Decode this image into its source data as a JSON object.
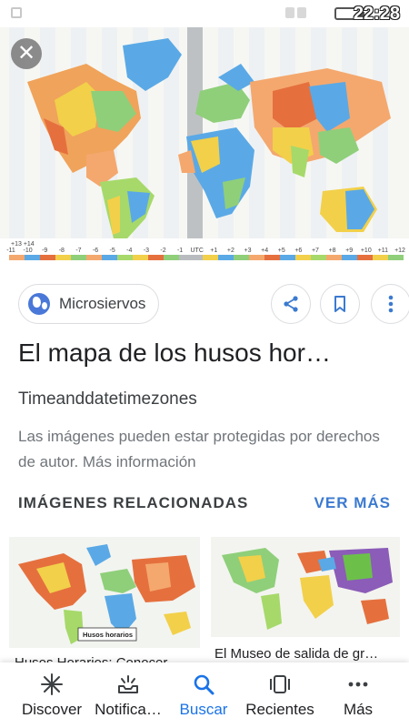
{
  "status": {
    "time": "22:28"
  },
  "hero": {
    "utc_labels": [
      "-11",
      "-10",
      "-9",
      "-8",
      "-7",
      "-6",
      "-5",
      "-4",
      "-3",
      "-2",
      "-1",
      "UTC",
      "+1",
      "+2",
      "+3",
      "+4",
      "+5",
      "+6",
      "+7",
      "+8",
      "+9",
      "+10",
      "+11",
      "+12"
    ],
    "top_offsets": "+13  +14"
  },
  "source": {
    "name": "Microsiervos"
  },
  "result": {
    "title": "El mapa de los husos hor…",
    "subtitle": "Timeanddatetimezones",
    "copyright": "Las imágenes pueden estar protegidas por derechos de autor. Más información"
  },
  "related": {
    "header": "IMÁGENES RELACIONADAS",
    "see_more": "VER MÁS",
    "items": [
      {
        "caption": "Husos Horarios: Conocer",
        "map_label": "Husos horarios"
      },
      {
        "caption": "El Museo de salida de gr…"
      }
    ]
  },
  "nav": {
    "items": [
      {
        "label": "Discover",
        "icon": "asterisk-icon"
      },
      {
        "label": "Notifica…",
        "icon": "notifications-icon"
      },
      {
        "label": "Buscar",
        "icon": "search-icon"
      },
      {
        "label": "Recientes",
        "icon": "recent-tabs-icon"
      },
      {
        "label": "Más",
        "icon": "more-dots-icon"
      }
    ],
    "active_index": 2
  },
  "colors": {
    "accent": "#1a73e8",
    "link": "#3b7ad0"
  }
}
